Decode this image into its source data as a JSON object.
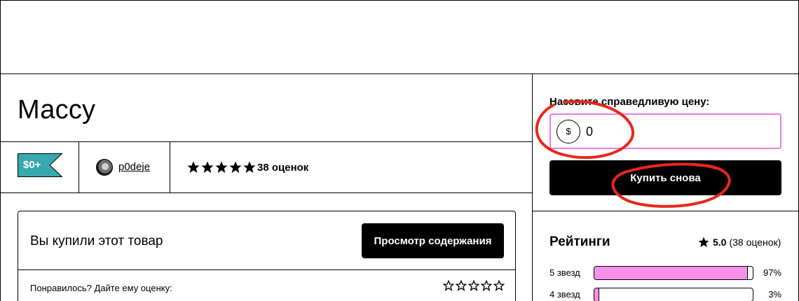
{
  "product": {
    "title": "Массу",
    "price_badge": "$0+",
    "seller_name": "p0deje",
    "rating_stars_filled": 5,
    "rating_count_label": "38 оценок"
  },
  "purchased_card": {
    "title": "Вы купили этот товар",
    "view_button_label": "Просмотр содержания",
    "rate_prompt": "Понравилось? Дайте ему оценку:",
    "rate_stars_total": 5
  },
  "payment": {
    "label": "Назовите справедливую цену:",
    "currency_symbol": "$",
    "amount_value": "0",
    "buy_button_label": "Купить снова"
  },
  "ratings": {
    "title": "Рейтинги",
    "average": "5.0",
    "count_label": "(38 оценок)",
    "bars": [
      {
        "label": "5 звезд",
        "percent_label": "97%",
        "fraction": 0.97
      },
      {
        "label": "4 звезд",
        "percent_label": "3%",
        "fraction": 0.03
      }
    ]
  },
  "colors": {
    "price_badge": "#36a9ae",
    "accent_pink": "#f690e8",
    "input_border": "#e37ee1",
    "annotation_red": "#e8281b"
  },
  "icons": {
    "rating_star": "star-filled-icon",
    "empty_star": "star-outline-icon",
    "currency": "dollar-icon"
  }
}
